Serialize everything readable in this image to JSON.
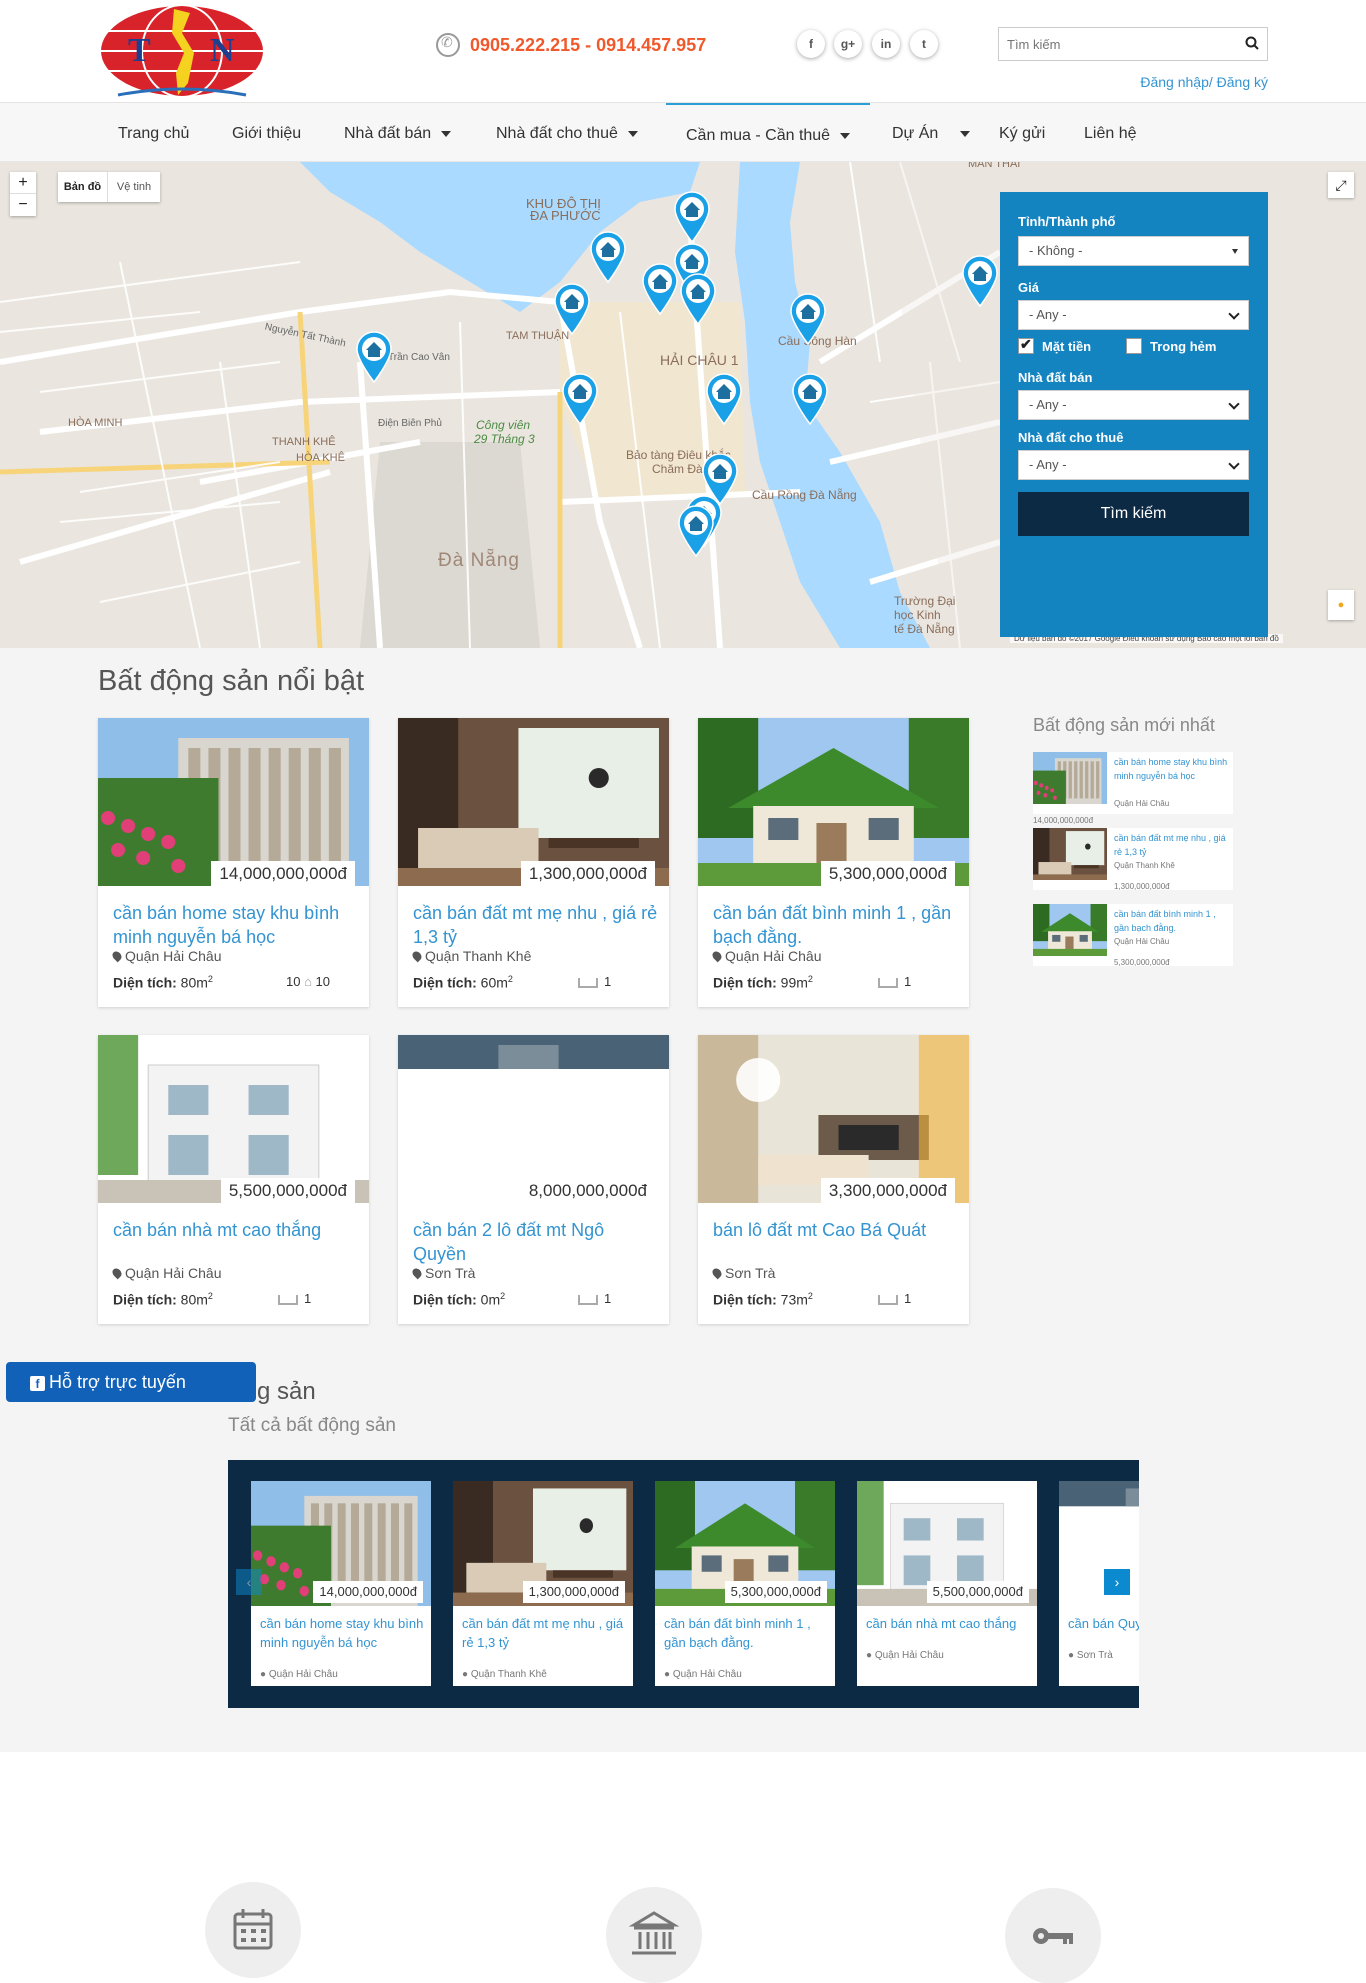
{
  "header": {
    "phone": "0905.222.215 - 0914.457.957",
    "social": [
      "f",
      "g+",
      "in",
      "t"
    ],
    "search_placeholder": "Tìm kiếm",
    "login": "Đăng nhập/ Đăng ký"
  },
  "nav": {
    "items": [
      {
        "label": "Trang chủ",
        "dropdown": false
      },
      {
        "label": "Giới thiệu",
        "dropdown": false
      },
      {
        "label": "Nhà đất bán",
        "dropdown": true
      },
      {
        "label": "Nhà đất cho thuê",
        "dropdown": true
      },
      {
        "label": "Cần mua - Cần thuê",
        "dropdown": true
      },
      {
        "label": "Dự Án",
        "dropdown": true
      },
      {
        "label": "Ký gửi",
        "dropdown": false
      },
      {
        "label": "Liên hệ",
        "dropdown": false
      }
    ],
    "active_index": 4
  },
  "map": {
    "type_map": "Bản đồ",
    "type_sat": "Vệ tinh",
    "zoom_in": "+",
    "zoom_out": "−",
    "attribution": "Dữ liệu bản đồ ©2017 Google   Điều khoản sử dụng   Báo cáo một lỗi bản đồ",
    "labels": {
      "district1": "KHU ĐÔ THỊ",
      "district1b": "ĐA PHƯỚC",
      "hai_chau": "HẢI CHÂU 1",
      "da_nang": "Đà Nẵng",
      "thanh_khe": "THANH KHÊ",
      "thanh_khe_b": "HÒA KHÊ",
      "hoa_minh": "HÒA MINH",
      "tam_thuan": "TAM THUẬN",
      "park1": "Công viên",
      "park2": "29 Tháng 3",
      "museum1": "Bảo tàng Điêu khắc",
      "museum2": "Chăm Đà",
      "bridge": "Cầu Rồng Đà Nẵng",
      "bridge2": "Cầu Sông Hàn",
      "school1": "Trường Đại",
      "school2": "học Kinh",
      "school3": "tế Đà Nẵng",
      "man_thai": "MÂN THÁI",
      "tran_cao_van": "Trần Cao Vân",
      "dien_bien_phu": "Điện Biên Phủ",
      "nguyen_tat_thanh": "Nguyễn Tất Thành"
    }
  },
  "search_panel": {
    "province_label": "Tỉnh/Thành phố",
    "province_value": "- Không -",
    "price_label": "Giá",
    "price_value": "- Any -",
    "check_front": "Mặt tiền",
    "check_alley": "Trong hẻm",
    "sale_label": "Nhà đất bán",
    "sale_value": "- Any -",
    "rent_label": "Nhà đất cho thuê",
    "rent_value": "- Any -",
    "button": "Tìm kiếm"
  },
  "featured": {
    "title": "Bất động sản nổi bật",
    "area_label": "Diện tích:",
    "cards": [
      {
        "price": "14,000,000,000đ",
        "title": "cần bán home stay khu bình minh nguyễn bá học",
        "location": "Quận Hải Châu",
        "area": "80m",
        "beds": "10",
        "baths": "10",
        "img": "modern"
      },
      {
        "price": "1,300,000,000đ",
        "title": "cần bán đất mt mẹ nhu , giá rẻ 1,3 tỷ",
        "location": "Quận Thanh Khê",
        "area": "60m",
        "beds": "1",
        "baths": "",
        "img": "interior"
      },
      {
        "price": "5,300,000,000đ",
        "title": "cần bán đất bình minh 1 , gần bạch đằng.",
        "location": "Quận Hải Châu",
        "area": "99m",
        "beds": "1",
        "baths": "",
        "img": "cottage"
      },
      {
        "price": "5,500,000,000đ",
        "title": "cần bán nhà mt cao thắng",
        "location": "Quận Hải Châu",
        "area": "80m",
        "beds": "1",
        "baths": "",
        "img": "villa"
      },
      {
        "price": "8,000,000,000đ",
        "title": "cần bán 2 lô đất mt Ngô Quyền",
        "location": "Sơn Trà",
        "area": "0m",
        "beds": "1",
        "baths": "",
        "img": "street"
      },
      {
        "price": "3,300,000,000đ",
        "title": "bán lô đất mt Cao Bá Quát",
        "location": "Sơn Trà",
        "area": "73m",
        "beds": "1",
        "baths": "",
        "img": "living"
      }
    ]
  },
  "newest": {
    "title": "Bất động sản mới nhất",
    "items": [
      {
        "title": "cần bán home stay khu bình minh nguyễn bá học",
        "location": "Quận Hải Châu",
        "price": "14,000,000,000đ",
        "img": "modern"
      },
      {
        "title": "cần bán đất mt mẹ nhu , giá rẻ 1,3 tỷ",
        "location": "Quận Thanh Khê",
        "price": "1,300,000,000đ",
        "img": "interior"
      },
      {
        "title": "cần bán đất bình minh 1 , gần bạch đằng.",
        "location": "Quận Hải Châu",
        "price": "5,300,000,000đ",
        "img": "cottage"
      }
    ]
  },
  "support": {
    "label": "Hỗ trợ trực tuyến"
  },
  "all": {
    "heading": "g sản",
    "sub": "Tất cả bất động sản",
    "cards": [
      {
        "price": "14,000,000,000đ",
        "title": "cần bán home stay khu bình minh nguyễn bá học",
        "location": "Quận Hải Châu",
        "img": "modern"
      },
      {
        "price": "1,300,000,000đ",
        "title": "cần bán đất mt mẹ nhu , giá rẻ 1,3 tỷ",
        "location": "Quận Thanh Khê",
        "img": "interior"
      },
      {
        "price": "5,300,000,000đ",
        "title": "cần bán đất bình minh 1 , gần bạch đằng.",
        "location": "Quận Hải Châu",
        "img": "cottage"
      },
      {
        "price": "5,500,000,000đ",
        "title": "cần bán nhà mt cao thắng",
        "location": "Quận Hải Châu",
        "img": "villa"
      },
      {
        "price": "",
        "title": "cần bán Quyền",
        "location": "Sơn Trà",
        "img": "street"
      }
    ],
    "prev": "‹",
    "next": "›"
  },
  "colors": {
    "accent": "#1484c1",
    "link": "#3394d1",
    "phone": "#f0592b",
    "dark": "#0c2a44"
  }
}
